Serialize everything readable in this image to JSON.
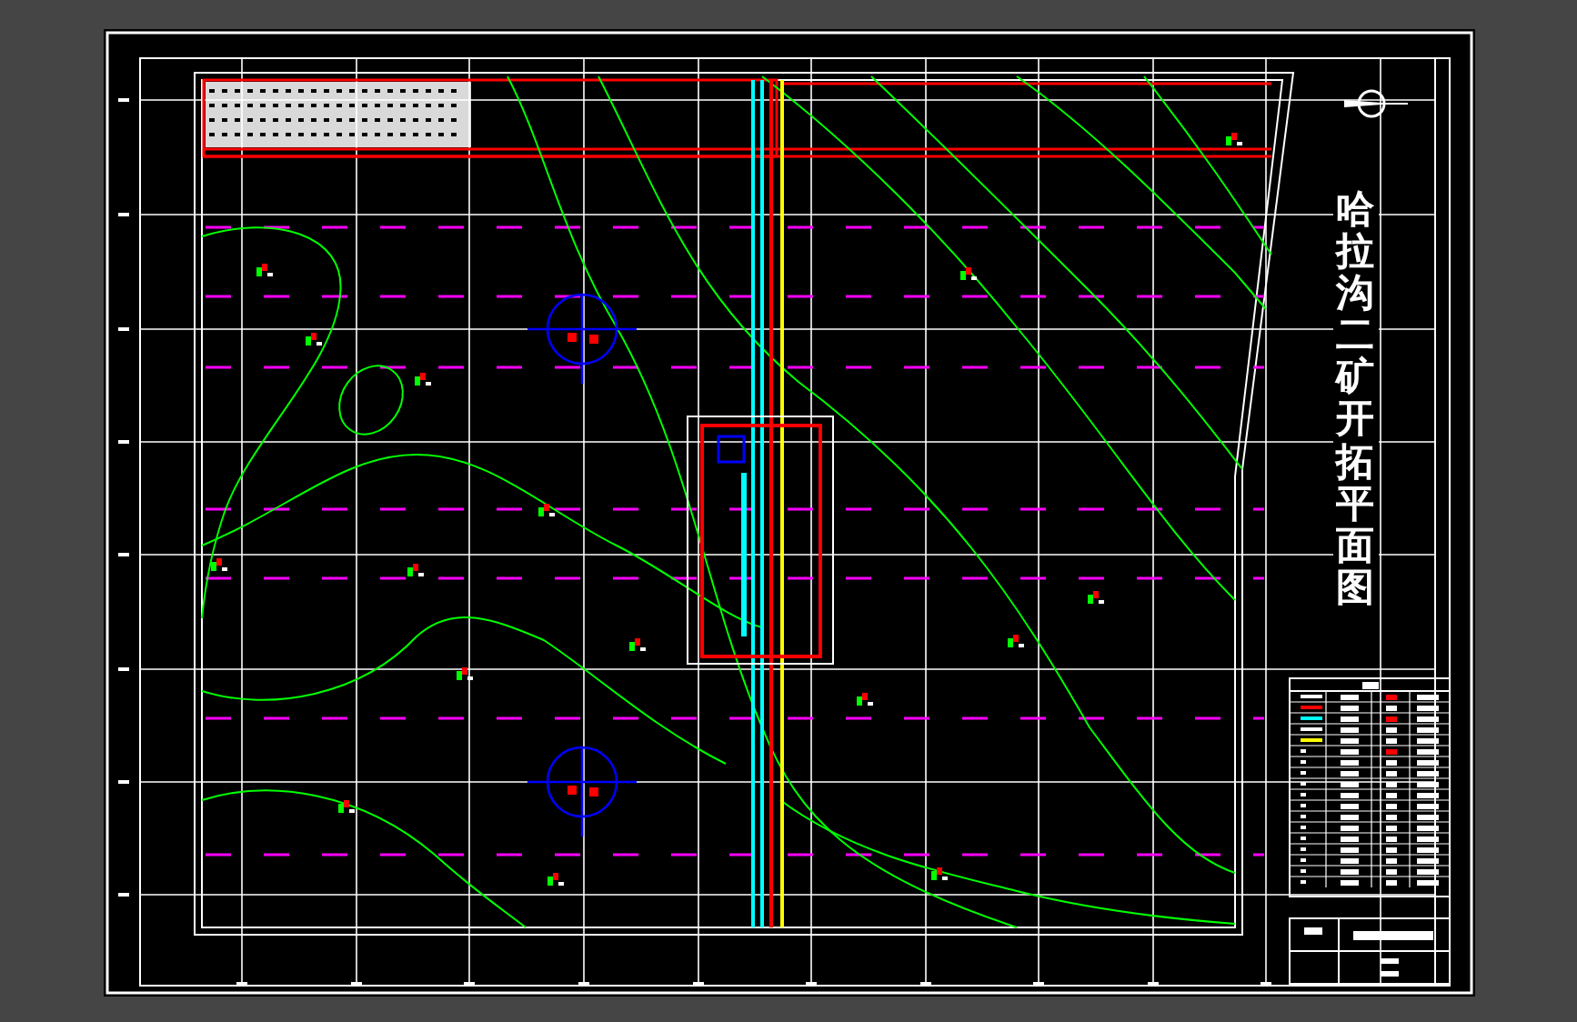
{
  "drawing": {
    "title": "哈拉沟二矿开拓平面图"
  }
}
